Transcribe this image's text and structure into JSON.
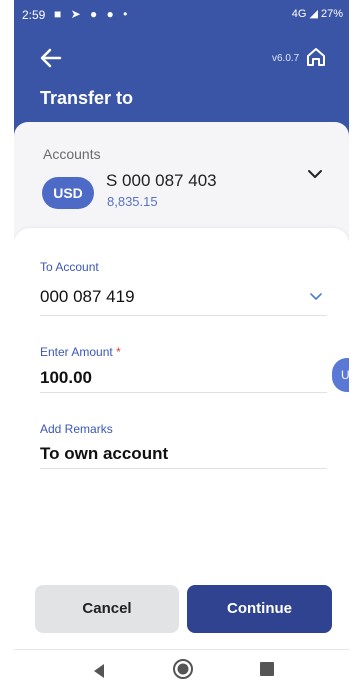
{
  "status_bar": {
    "time": "2:59",
    "left_icons": "■ ➤ ● ● •",
    "right_text": "4G ◢ 27%"
  },
  "header": {
    "version": "v6.0.7",
    "title": "Transfer to",
    "back_icon": "arrow-left",
    "home_icon": "home"
  },
  "accounts": {
    "label": "Accounts",
    "currency": "USD",
    "number": "S 000 087 403",
    "balance": "8,835.15"
  },
  "form": {
    "to_account_label": "To Account",
    "to_account_value": "000 087 419",
    "amount_label": "Enter Amount",
    "amount_required": "*",
    "amount_value": "100.00",
    "remarks_label": "Add Remarks",
    "remarks_value": "To own account"
  },
  "side_tab": {
    "letter": "U"
  },
  "buttons": {
    "cancel": "Cancel",
    "continue": "Continue"
  },
  "colors": {
    "brand": "#3a55a5",
    "accent": "#2f4390",
    "label": "#3b57b7"
  }
}
